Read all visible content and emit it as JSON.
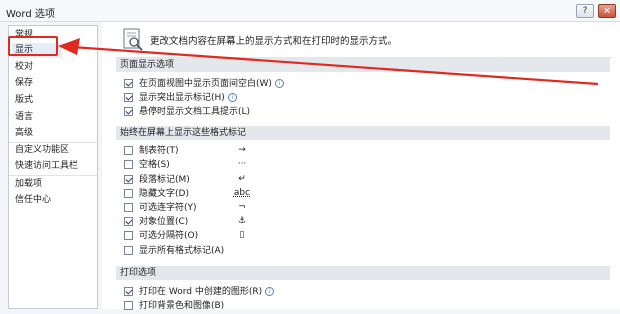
{
  "window": {
    "title": "Word 选项",
    "help_label": "?",
    "close_label": "×"
  },
  "sidebar": {
    "items": [
      {
        "label": "常规"
      },
      {
        "label": "显示"
      },
      {
        "label": "校对"
      },
      {
        "label": "保存"
      },
      {
        "label": "版式"
      },
      {
        "label": "语言"
      },
      {
        "label": "高级"
      },
      {
        "label": "自定义功能区"
      },
      {
        "label": "快速访问工具栏"
      },
      {
        "label": "加载项"
      },
      {
        "label": "信任中心"
      }
    ],
    "selected": "显示"
  },
  "main": {
    "header": "更改文档内容在屏幕上的显示方式和在打印时的显示方式。",
    "sections": {
      "page_display": {
        "title": "页面显示选项",
        "options": [
          {
            "label": "在页面视图中显示页面间空白(W)",
            "checked": true,
            "info": "i"
          },
          {
            "label": "显示突出显示标记(H)",
            "checked": true,
            "info": "i"
          },
          {
            "label": "悬停时显示文档工具提示(L)",
            "checked": true
          }
        ]
      },
      "format_marks": {
        "title": "始终在屏幕上显示这些格式标记",
        "options": [
          {
            "label": "制表符(T)",
            "checked": false,
            "symbol": "→"
          },
          {
            "label": "空格(S)",
            "checked": false,
            "symbol": "···"
          },
          {
            "label": "段落标记(M)",
            "checked": true,
            "symbol": "↵"
          },
          {
            "label": "隐藏文字(D)",
            "checked": false,
            "symbol": "abc"
          },
          {
            "label": "可选连字符(Y)",
            "checked": false,
            "symbol": "¬"
          },
          {
            "label": "对象位置(C)",
            "checked": true,
            "symbol": "⚓"
          },
          {
            "label": "可选分隔符(O)",
            "checked": false,
            "symbol": "▯"
          },
          {
            "label": "显示所有格式标记(A)",
            "checked": false
          }
        ]
      },
      "print": {
        "title": "打印选项",
        "options": [
          {
            "label": "打印在 Word 中创建的图形(R)",
            "checked": true,
            "info": "i"
          },
          {
            "label": "打印背景色和图像(B)",
            "checked": false
          }
        ]
      }
    }
  },
  "colors": {
    "annotation_red": "#e0291f",
    "selected_bg": "#e5edf9",
    "section_bg": "#e4e7ec"
  }
}
